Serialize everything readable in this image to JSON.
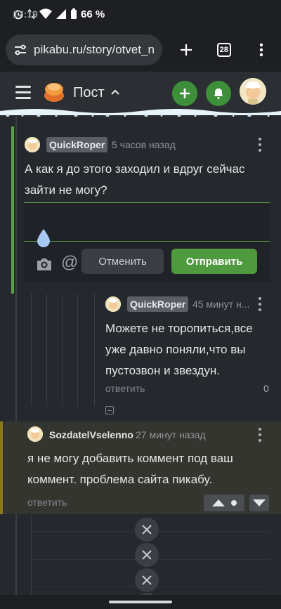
{
  "status_bar": {
    "time": "17:19",
    "battery": "66 %"
  },
  "browser": {
    "url": "pikabu.ru/story/otvet_n",
    "tab_count": "28"
  },
  "header": {
    "title": "Пост"
  },
  "comments": [
    {
      "user": "QuickRoper",
      "time": "5 часов назад",
      "text": "А как я до этого заходил и вдруг сейчас зайти не могу?"
    },
    {
      "user": "QuickRoper",
      "time": "45 минут н...",
      "text": "Можете не торопиться,все уже давно поняли,что вы пустозвон и звездун.",
      "reply_label": "ответить",
      "rating": "0"
    },
    {
      "user": "SozdatelVselenno",
      "time": "27 минут назад",
      "text": "я не могу добавить коммент под ваш коммент. проблема сайта пикабу.",
      "reply_label": "ответить"
    }
  ],
  "reply_form": {
    "cancel_label": "Отменить",
    "send_label": "Отправить"
  },
  "colors": {
    "accent_green": "#4f9a3e",
    "background": "#25282c",
    "highlight": "#34352f"
  }
}
